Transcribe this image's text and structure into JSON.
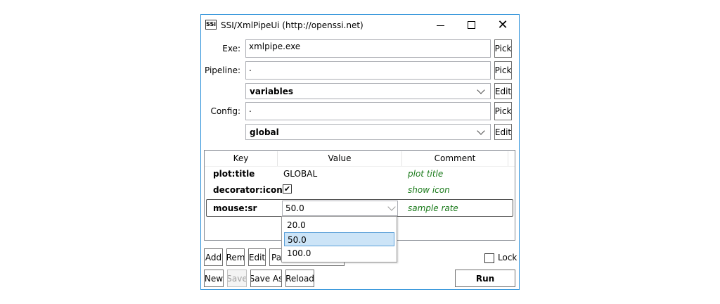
{
  "window": {
    "title": "SSI/XmlPipeUi (http://openssi.net)",
    "icon": "app-logo-icon",
    "logo_text": "SSi"
  },
  "form": {
    "exe_label": "Exe:",
    "exe_value": "xmlpipe.exe",
    "pipeline_label": "Pipeline:",
    "pipeline_value": ".",
    "pipeline_select": "variables",
    "config_label": "Config:",
    "config_value": ".",
    "config_select": "global",
    "pick_label": "Pick",
    "edit_label": "Edit"
  },
  "grid": {
    "columns": [
      "Key",
      "Value",
      "Comment"
    ],
    "rows": [
      {
        "key": "plot:title",
        "value": "GLOBAL",
        "comment": "plot title"
      },
      {
        "key": "decorator:icon",
        "value": "checked",
        "comment": "show icon"
      },
      {
        "key": "mouse:sr",
        "value": "50.0",
        "comment": "sample rate"
      }
    ],
    "dropdown_options": [
      "20.0",
      "50.0",
      "100.0"
    ],
    "dropdown_selected": "50.0"
  },
  "buttons": {
    "add": "Add",
    "rem": "Rem",
    "edit": "Edit",
    "par": "Par",
    "new": "New",
    "save": "Save",
    "save_as": "Save As",
    "reload": "Reload",
    "run": "Run"
  },
  "lock": {
    "label": "Lock",
    "checked": false
  },
  "colors": {
    "accent": "#2b90d9",
    "selection": "#cce4f7",
    "comment": "#1a7a1a"
  }
}
